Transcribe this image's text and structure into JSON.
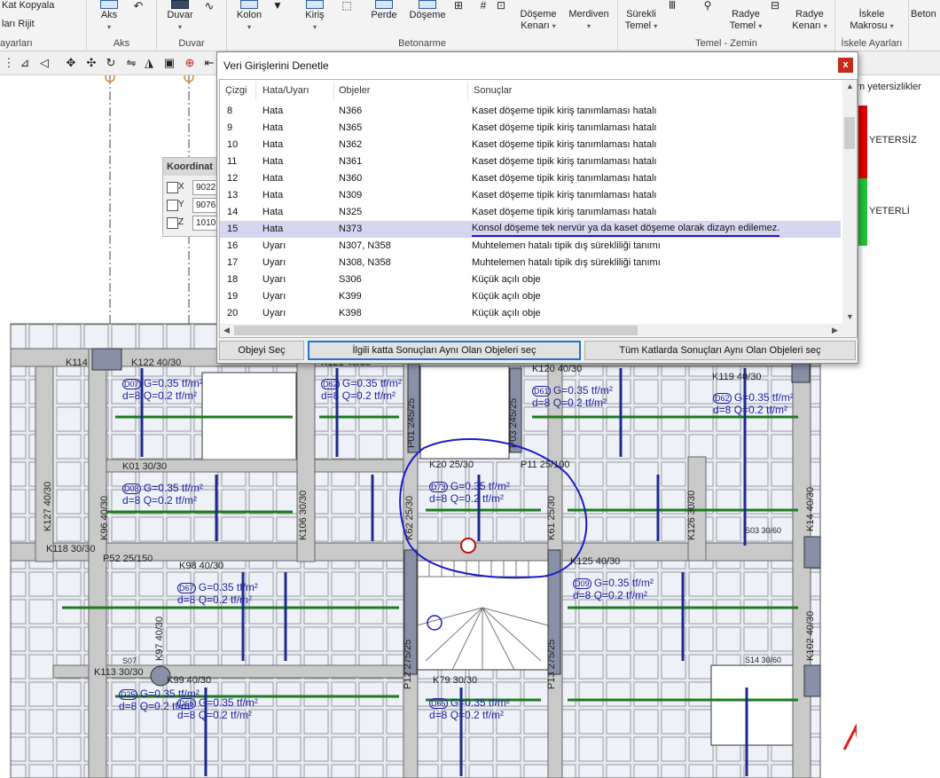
{
  "ribbon": {
    "groups": [
      {
        "title": "ayarları",
        "items": [
          "Kat Kopyala",
          "ları Rijit"
        ]
      },
      {
        "title": "Aks",
        "items": [
          "Aks"
        ]
      },
      {
        "title": "Duvar",
        "items": [
          "Duvar"
        ]
      },
      {
        "title": "Betonarme",
        "items": [
          "Kolon",
          "Kiriş",
          "Perde",
          "Döşeme",
          "Döşeme Kenarı",
          "Merdiven"
        ]
      },
      {
        "title": "Temel - Zemin",
        "items": [
          "Sürekli Temel",
          "Radye Temel",
          "Radye Kenarı"
        ]
      },
      {
        "title": "İskele Ayarları",
        "items": [
          "İskele Makrosu"
        ]
      },
      {
        "title": "",
        "items": [
          "Beton"
        ]
      }
    ]
  },
  "coord_panel": {
    "title": "Koordinat",
    "rows": [
      {
        "axis": "X",
        "value": "9022"
      },
      {
        "axis": "Y",
        "value": "9076"
      },
      {
        "axis": "Z",
        "value": "1010"
      }
    ]
  },
  "side_panel": {
    "header": "m yetersizlikler",
    "bad_label": "YETERSİZ",
    "good_label": "YETERLİ",
    "bad_color": "#e00000",
    "good_color": "#21c437"
  },
  "dialog": {
    "title": "Veri Girişlerini Denetle",
    "close_label": "x",
    "columns": [
      "Çizgi",
      "Hata/Uyarı",
      "Objeler",
      "Sonuçlar"
    ],
    "rows": [
      {
        "line": "8",
        "type": "Hata",
        "objects": "N366",
        "result": "Kaset döşeme tipik kiriş tanımlaması hatalı"
      },
      {
        "line": "9",
        "type": "Hata",
        "objects": "N365",
        "result": "Kaset döşeme tipik kiriş tanımlaması hatalı"
      },
      {
        "line": "10",
        "type": "Hata",
        "objects": "N362",
        "result": "Kaset döşeme tipik kiriş tanımlaması hatalı"
      },
      {
        "line": "11",
        "type": "Hata",
        "objects": "N361",
        "result": "Kaset döşeme tipik kiriş tanımlaması hatalı"
      },
      {
        "line": "12",
        "type": "Hata",
        "objects": "N360",
        "result": "Kaset döşeme tipik kiriş tanımlaması hatalı"
      },
      {
        "line": "13",
        "type": "Hata",
        "objects": "N309",
        "result": "Kaset döşeme tipik kiriş tanımlaması hatalı"
      },
      {
        "line": "14",
        "type": "Hata",
        "objects": "N325",
        "result": "Kaset döşeme tipik kiriş tanımlaması hatalı"
      },
      {
        "line": "15",
        "type": "Hata",
        "objects": "N373",
        "result": "Konsol döşeme tek nervür ya da kaset döşeme olarak dizayn edilemez.",
        "selected": true
      },
      {
        "line": "16",
        "type": "Uyarı",
        "objects": "N307, N358",
        "result": "Muhtelemen hatalı tipik dış sürekliliği tanımı"
      },
      {
        "line": "17",
        "type": "Uyarı",
        "objects": "N308, N358",
        "result": "Muhtelemen hatalı tipik dış sürekliliği tanımı"
      },
      {
        "line": "18",
        "type": "Uyarı",
        "objects": "S306",
        "result": "Küçük açılı obje"
      },
      {
        "line": "19",
        "type": "Uyarı",
        "objects": "K399",
        "result": "Küçük açılı obje"
      },
      {
        "line": "20",
        "type": "Uyarı",
        "objects": "K398",
        "result": "Küçük açılı obje"
      }
    ],
    "buttons": {
      "select_object": "Objeyi Seç",
      "select_same_floor": "İlgili katta Sonuçları Aynı Olan Objeleri seç",
      "select_all_floors": "Tüm Katlarda Sonuçları Aynı Olan Objeleri seç"
    }
  },
  "drawing": {
    "beam_labels": [
      "K114",
      "K122 40/30",
      "K121 40/30",
      "K120 40/30",
      "K119 40/30",
      "K01 30/30",
      "K20 25/30",
      "P11 25/100",
      "K118 30/30",
      "P52 25/150",
      "K98 40/30",
      "K125 40/30",
      "K113 30/30",
      "K99 40/30",
      "K79 30/30",
      "S07",
      "S03 30/60",
      "S14 30/60"
    ],
    "vertical_labels": [
      "K127 40/30",
      "K96 40/30",
      "K106 30/30",
      "P01 245/25",
      "P03 245/25",
      "K62 25/30",
      "K61 25/30",
      "K126 30/30",
      "K14 40/30",
      "K97 40/30",
      "P12 275/25",
      "P13 275/25",
      "K102 40/30"
    ],
    "slab_labels": [
      {
        "id": "D07",
        "g": "G=0.35 tf/m²",
        "q": "d=8 Q=0.2 tf/m²"
      },
      {
        "id": "D62",
        "g": "G=0.35 tf/m²",
        "q": "d=8 Q=0.2 tf/m²"
      },
      {
        "id": "D61",
        "g": "G=0.35 tf/m²",
        "q": "d=8 Q=0.2 tf/m²"
      },
      {
        "id": "D62",
        "g": "G=0.35 tf/m²",
        "q": "d=8 Q=0.2 tf/m²"
      },
      {
        "id": "D08",
        "g": "G=0.35 tf/m²",
        "q": "d=8 Q=0.2 tf/m²"
      },
      {
        "id": "D73",
        "g": "G=0.35 tf/m²",
        "q": "d=8 Q=0.2 tf/m²"
      },
      {
        "id": "D67",
        "g": "G=0.35 tf/m²",
        "q": "d=8 Q=0.2 tf/m²"
      },
      {
        "id": "D09",
        "g": "G=0.35 tf/m²",
        "q": "d=8 Q=0.2 tf/m²"
      },
      {
        "id": "D66",
        "g": "G=0.35 tf/m²",
        "q": "d=8 Q=0.2 tf/m²"
      },
      {
        "id": "D65",
        "g": "G=0.35 tf/m²",
        "q": "d=8 Q=0.2 tf/m²"
      },
      {
        "id": "D25",
        "g": "G=0.35 tf/m²",
        "q": "d=8 Q=0.2 tf/m²"
      }
    ]
  }
}
